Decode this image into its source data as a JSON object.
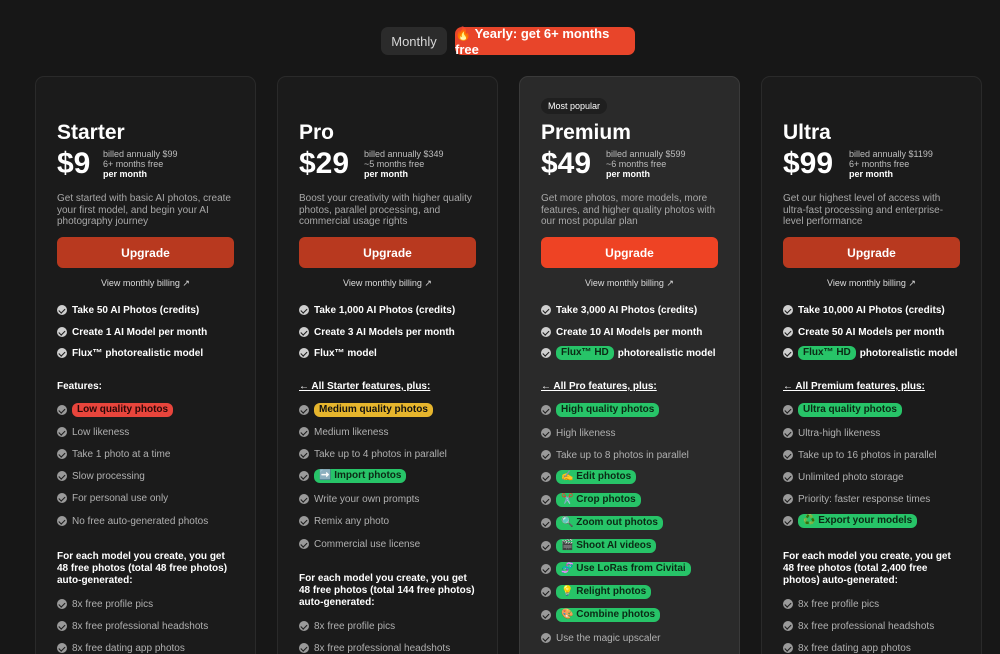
{
  "toggle": {
    "monthly": "Monthly",
    "yearly": "🔥 Yearly: get 6+ months free"
  },
  "plans": [
    {
      "name": "Starter",
      "price": "$9",
      "billing1": "billed annually $99",
      "billing2": "6+ months free",
      "billing3": "per month",
      "desc": "Get started with basic AI photos, create your first model, and begin your AI photography journey",
      "upgrade": "Upgrade",
      "view_monthly": "View monthly billing ↗",
      "core": [
        "Take 50 AI Photos (credits)",
        "Create 1 AI Model per month",
        "Flux™ photorealistic model"
      ],
      "features_header": "Features:",
      "features": [
        "Low quality photos",
        "Low likeness",
        "Take 1 photo at a time",
        "Slow processing",
        "For personal use only",
        "No free auto-generated photos"
      ],
      "free_header": "For each model you create, you get 48 free photos (total 48 free photos) auto-generated:",
      "free": [
        "8x free profile pics",
        "8x free professional headshots",
        "8x free dating app photos"
      ]
    },
    {
      "name": "Pro",
      "price": "$29",
      "billing1": "billed annually $349",
      "billing2": "~5 months free",
      "billing3": "per month",
      "desc": "Boost your creativity with higher quality photos, parallel processing, and commercial usage rights",
      "upgrade": "Upgrade",
      "view_monthly": "View monthly billing ↗",
      "core": [
        "Take 1,000 AI Photos (credits)",
        "Create 3 AI Models per month",
        "Flux™ model"
      ],
      "features_header": "← All Starter features, plus:",
      "features": [
        "Medium quality photos",
        "Medium likeness",
        "Take up to 4 photos in parallel",
        "➡️ Import photos",
        "Write your own prompts",
        "Remix any photo",
        "Commercial use license"
      ],
      "free_header": "For each model you create, you get 48 free photos (total 144 free photos) auto-generated:",
      "free": [
        "8x free profile pics",
        "8x free professional headshots"
      ]
    },
    {
      "name": "Premium",
      "price": "$49",
      "badge": "Most popular",
      "billing1": "billed annually $599",
      "billing2": "~6 months free",
      "billing3": "per month",
      "desc": "Get more photos, more models, more features, and higher quality photos with our most popular plan",
      "upgrade": "Upgrade",
      "view_monthly": "View monthly billing ↗",
      "core": [
        "Take 3,000 AI Photos (credits)",
        "Create 10 AI Models per month",
        "photorealistic model"
      ],
      "core_pill": "Flux™ HD",
      "features_header": "← All Pro features, plus:",
      "features": [
        "High quality photos",
        "High likeness",
        "Take up to 8 photos in parallel",
        "✍️ Edit photos",
        "✂️ Crop photos",
        "🔍 Zoom out photos",
        "🎬 Shoot AI videos",
        "🧬 Use LoRas from Civitai",
        "💡 Relight photos",
        "🎨 Combine photos",
        "Use the magic upscaler"
      ]
    },
    {
      "name": "Ultra",
      "price": "$99",
      "billing1": "billed annually $1199",
      "billing2": "6+ months free",
      "billing3": "per month",
      "desc": "Get our highest level of access with ultra-fast processing and enterprise-level performance",
      "upgrade": "Upgrade",
      "view_monthly": "View monthly billing ↗",
      "core": [
        "Take 10,000 AI Photos (credits)",
        "Create 50 AI Models per month",
        "photorealistic model"
      ],
      "core_pill": "Flux™ HD",
      "features_header": "← All Premium features, plus:",
      "features": [
        "Ultra quality photos",
        "Ultra-high likeness",
        "Take up to 16 photos in parallel",
        "Unlimited photo storage",
        "Priority: faster response times",
        "♻️ Export your models"
      ],
      "free_header": "For each model you create, you get 48 free photos (total 2,400 free photos) auto-generated:",
      "free": [
        "8x free profile pics",
        "8x free professional headshots",
        "8x free dating app photos"
      ]
    }
  ],
  "colors": {
    "accent": "#ee4324",
    "pill_red": "#e8453c",
    "pill_yellow": "#e6b52d",
    "pill_green": "#27c468"
  }
}
